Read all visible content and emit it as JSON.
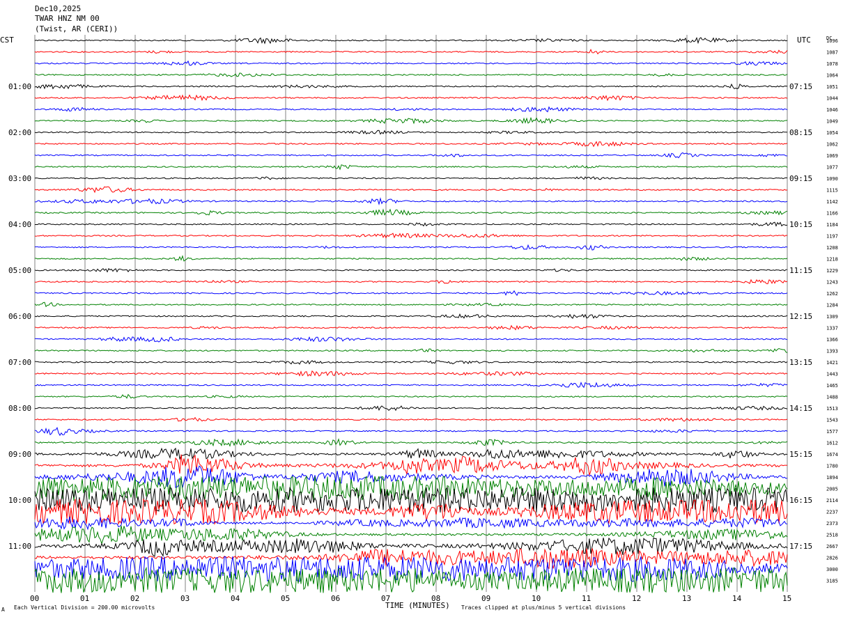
{
  "header": {
    "date": "Dec10,2025",
    "station": "TWAR HNZ NM 00",
    "location": "(Twist, AR (CERI))"
  },
  "left_tz": "CST",
  "right_tz": "UTC",
  "dc_label": "DC",
  "footer": {
    "scale": "Each Vertical Division =  200.00 microvolts",
    "xlabel": "TIME (MINUTES)",
    "clip_note": "Traces clipped at plus/minus 5 vertical divisions",
    "corner_mark": "A"
  },
  "colors": {
    "cycle": [
      "#000000",
      "#ff0000",
      "#0000ff",
      "#008000"
    ],
    "grid": "#808080"
  },
  "chart_data": {
    "type": "line",
    "xlabel": "TIME (MINUTES)",
    "xlim": [
      0,
      15
    ],
    "x_ticks": [
      "00",
      "01",
      "02",
      "03",
      "04",
      "05",
      "06",
      "07",
      "08",
      "09",
      "10",
      "11",
      "12",
      "13",
      "14",
      "15"
    ],
    "trace_count": 48,
    "minutes_per_trace": 15,
    "left_hour_labels": [
      "01:00",
      "02:00",
      "03:00",
      "04:00",
      "05:00",
      "06:00",
      "07:00",
      "08:00",
      "09:00",
      "10:00",
      "11:00"
    ],
    "right_hour_labels": [
      "07:15",
      "08:15",
      "09:15",
      "10:15",
      "11:15",
      "12:15",
      "13:15",
      "14:15",
      "15:15",
      "16:15",
      "17:15"
    ],
    "dc_offsets": [
      "1096",
      "1087",
      "1078",
      "1064",
      "1051",
      "1044",
      "1046",
      "1049",
      "1054",
      "1062",
      "1069",
      "1077",
      "1090",
      "1115",
      "1142",
      "1166",
      "1184",
      "1197",
      "1208",
      "1218",
      "1229",
      "1243",
      "1262",
      "1284",
      "1309",
      "1337",
      "1366",
      "1393",
      "1421",
      "1443",
      "1465",
      "1488",
      "1513",
      "1543",
      "1577",
      "1612",
      "1674",
      "1780",
      "1894",
      "2005",
      "2114",
      "2237",
      "2373",
      "2518",
      "2667",
      "2826",
      "3000",
      "3185"
    ],
    "noise_level": [
      1,
      1,
      1,
      1,
      1,
      1,
      1,
      1,
      1,
      1,
      1,
      1,
      1,
      1.2,
      1.2,
      1.2,
      1,
      1,
      1,
      1,
      1,
      1,
      1.1,
      1,
      1,
      1,
      1,
      1,
      1.1,
      1,
      1,
      1,
      1,
      1,
      1,
      1.2,
      2.5,
      4,
      4,
      6,
      6,
      6,
      3,
      3,
      4,
      5,
      6,
      6
    ]
  }
}
